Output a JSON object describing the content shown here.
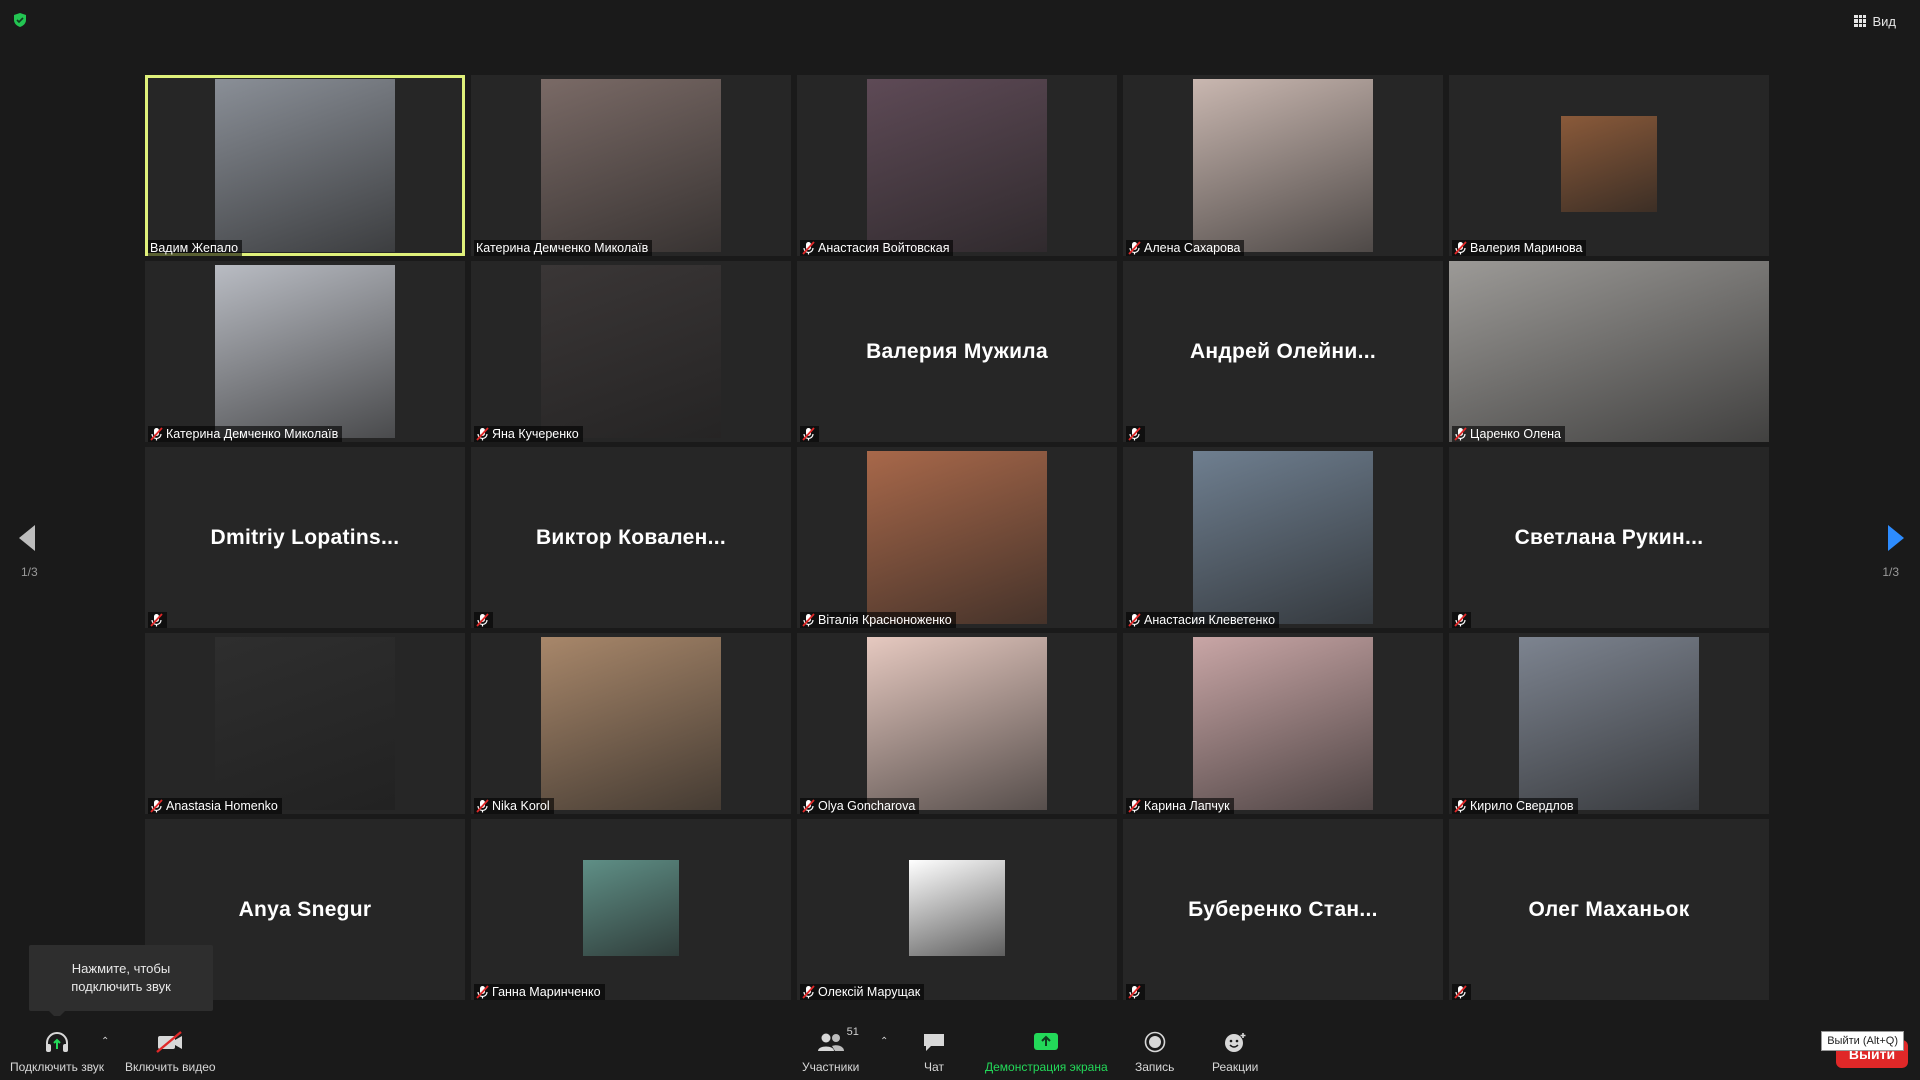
{
  "topbar": {
    "view_label": "Вид"
  },
  "pagination": {
    "left": "1/3",
    "right": "1/3"
  },
  "tooltip": {
    "line1": "Нажмите, чтобы",
    "line2": "подключить звук"
  },
  "participants": [
    {
      "name": "Вадим Жепало",
      "video": true,
      "muted": false,
      "active": true,
      "color": "#8a8f97"
    },
    {
      "name": "Катерина Демченко Миколаїв",
      "video": true,
      "muted": false,
      "color": "#7a6a66"
    },
    {
      "name": "Анастасия Войтовская",
      "video": true,
      "muted": true,
      "color": "#5e4a56"
    },
    {
      "name": "Алена Сахарова",
      "video": true,
      "muted": true,
      "color": "#c9b7b0"
    },
    {
      "name": "Валерия Маринова",
      "video": true,
      "muted": true,
      "small": true,
      "color": "#8a5a3a"
    },
    {
      "name": "Катерина Демченко Миколаїв",
      "video": true,
      "muted": true,
      "color": "#b9bcc3"
    },
    {
      "name": "Яна Кучеренко",
      "video": true,
      "muted": true,
      "color": "#3a3636"
    },
    {
      "name": "Валерия Мужила",
      "video": false,
      "muted": true,
      "display": "Валерия Мужила"
    },
    {
      "name": "Андрей Олейни...",
      "video": false,
      "muted": true,
      "display": "Андрей  Олейни..."
    },
    {
      "name": "Царенко Олена",
      "video": true,
      "muted": true,
      "wide": true,
      "color": "#9c9a97"
    },
    {
      "name": "Dmitriy Lopatins...",
      "video": false,
      "muted": true,
      "display": "Dmitriy  Lopatins..."
    },
    {
      "name": "Виктор Ковален...",
      "video": false,
      "muted": true,
      "display": "Виктор  Ковален..."
    },
    {
      "name": "Віталія Красноноженко",
      "video": true,
      "muted": true,
      "color": "#a8684a"
    },
    {
      "name": "Анастасия Клеветенко",
      "video": true,
      "muted": true,
      "color": "#6f7f90"
    },
    {
      "name": "Светлана Рукин...",
      "video": false,
      "muted": true,
      "display": "Светлана  Рукин..."
    },
    {
      "name": "Anastasia Homenko",
      "video": true,
      "muted": true,
      "color": "#2e2e2e"
    },
    {
      "name": "Nika Korol",
      "video": true,
      "muted": true,
      "color": "#a8876a"
    },
    {
      "name": "Olya Goncharova",
      "video": true,
      "muted": true,
      "color": "#e6c9c0"
    },
    {
      "name": "Карина Лапчук",
      "video": true,
      "muted": true,
      "color": "#c9a6a6"
    },
    {
      "name": "Кирило Свердлов",
      "video": true,
      "muted": true,
      "color": "#7d8490"
    },
    {
      "name": "Anya Snegur",
      "video": false,
      "muted": false,
      "display": "Anya Snegur"
    },
    {
      "name": "Ганна Маринченко",
      "video": true,
      "muted": true,
      "small": true,
      "color": "#5f8f86"
    },
    {
      "name": "Олексій Марущак",
      "video": true,
      "muted": true,
      "small": true,
      "color": "#ffffff"
    },
    {
      "name": "Буберенко Стан...",
      "video": false,
      "muted": true,
      "display": "Буберенко  Стан..."
    },
    {
      "name": "Олег Маханьок",
      "video": false,
      "muted": true,
      "display": "Олег Маханьок"
    }
  ],
  "toolbar": {
    "audio": "Подключить звук",
    "video": "Включить видео",
    "participants": "Участники",
    "participants_count": "51",
    "chat": "Чат",
    "share": "Демонстрация экрана",
    "record": "Запись",
    "reactions": "Реакции",
    "leave": "Выйти",
    "leave_tooltip": "Выйти (Alt+Q)"
  },
  "colors": {
    "active_border": "#dff07a",
    "share_green": "#23d959",
    "leave_red": "#e02828",
    "arrow_blue": "#2d8cff"
  }
}
